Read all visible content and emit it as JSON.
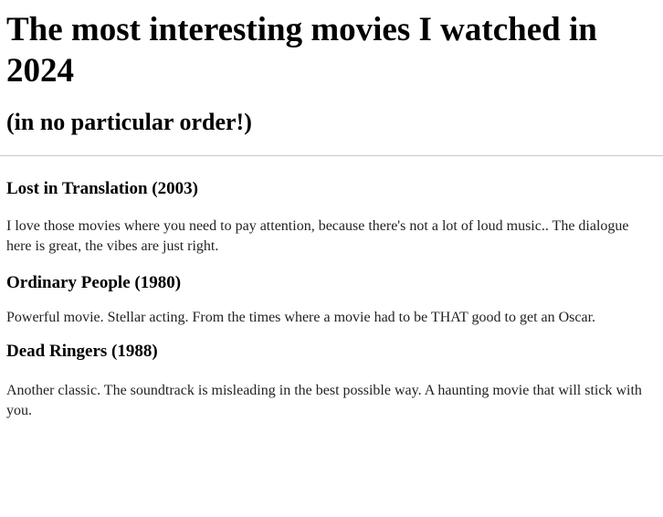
{
  "page": {
    "title": "The most interesting movies I watched in 2024",
    "subtitle": "(in no particular order!)"
  },
  "movies": [
    {
      "title": "Lost in Translation (2003)",
      "review": "I love those movies where you need to pay attention, because there's not a lot of loud music.. The dialogue here is great, the vibes are just right."
    },
    {
      "title": "Ordinary People (1980)",
      "review": "Powerful movie. Stellar acting. From the times where a movie had to be THAT good to get an Oscar."
    },
    {
      "title": "Dead Ringers (1988)",
      "review": "Another classic. The soundtrack is misleading in the best possible way. A haunting movie that will stick with you."
    }
  ]
}
